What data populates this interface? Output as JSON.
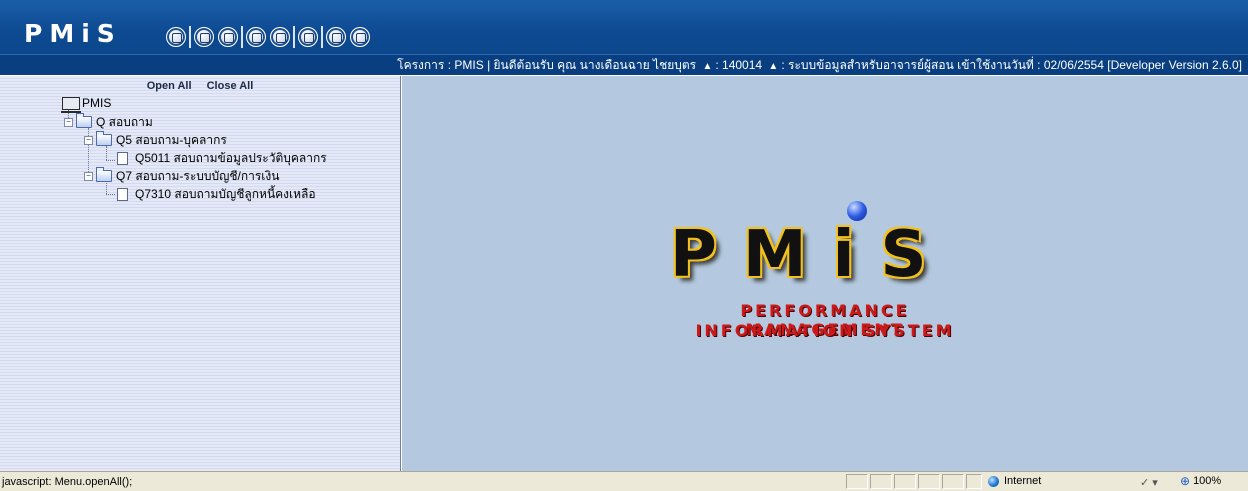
{
  "app": {
    "logo_text": "PMiS"
  },
  "toolbar": {
    "buttons": [
      "tool-icon-1",
      "tool-icon-2",
      "tool-icon-3",
      "tool-icon-4",
      "tool-icon-5",
      "tool-icon-6",
      "tool-icon-7",
      "tool-icon-8"
    ]
  },
  "info_bar": {
    "project_label": "โครงการ :",
    "project_name": "PMIS",
    "welcome": "| ยินดีต้อนรับ คุณ นางเดือนฉาย ไชยบุตร",
    "user_id": ": 140014",
    "system": ": ระบบข้อมูลสำหรับอาจารย์ผู้สอน",
    "login_date": "เข้าใช้งานวันที่ : 02/06/2554",
    "version": "[Developer Version 2.6.0]"
  },
  "menu": {
    "open_all": "Open All",
    "close_all": "Close All",
    "root": "PMIS",
    "items": [
      {
        "label": "Q สอบถาม"
      },
      {
        "label": "Q5 สอบถาม-บุคลากร"
      },
      {
        "label": "Q5011 สอบถามข้อมูลประวัติบุคลากร"
      },
      {
        "label": "Q7 สอบถาม-ระบบบัญชี/การเงิน"
      },
      {
        "label": "Q7310 สอบถามบัญชีลูกหนี้คงเหลือ"
      }
    ]
  },
  "brand": {
    "letters": "PMiS",
    "tagline_1": "PERFORMANCE MANAGEMENT",
    "tagline_2": "INFORMATION SYSTEM",
    "accent_color": "#cc1a1a"
  },
  "statusbar": {
    "text": "javascript: Menu.openAll();",
    "zone": "Internet",
    "zoom": "100%"
  }
}
